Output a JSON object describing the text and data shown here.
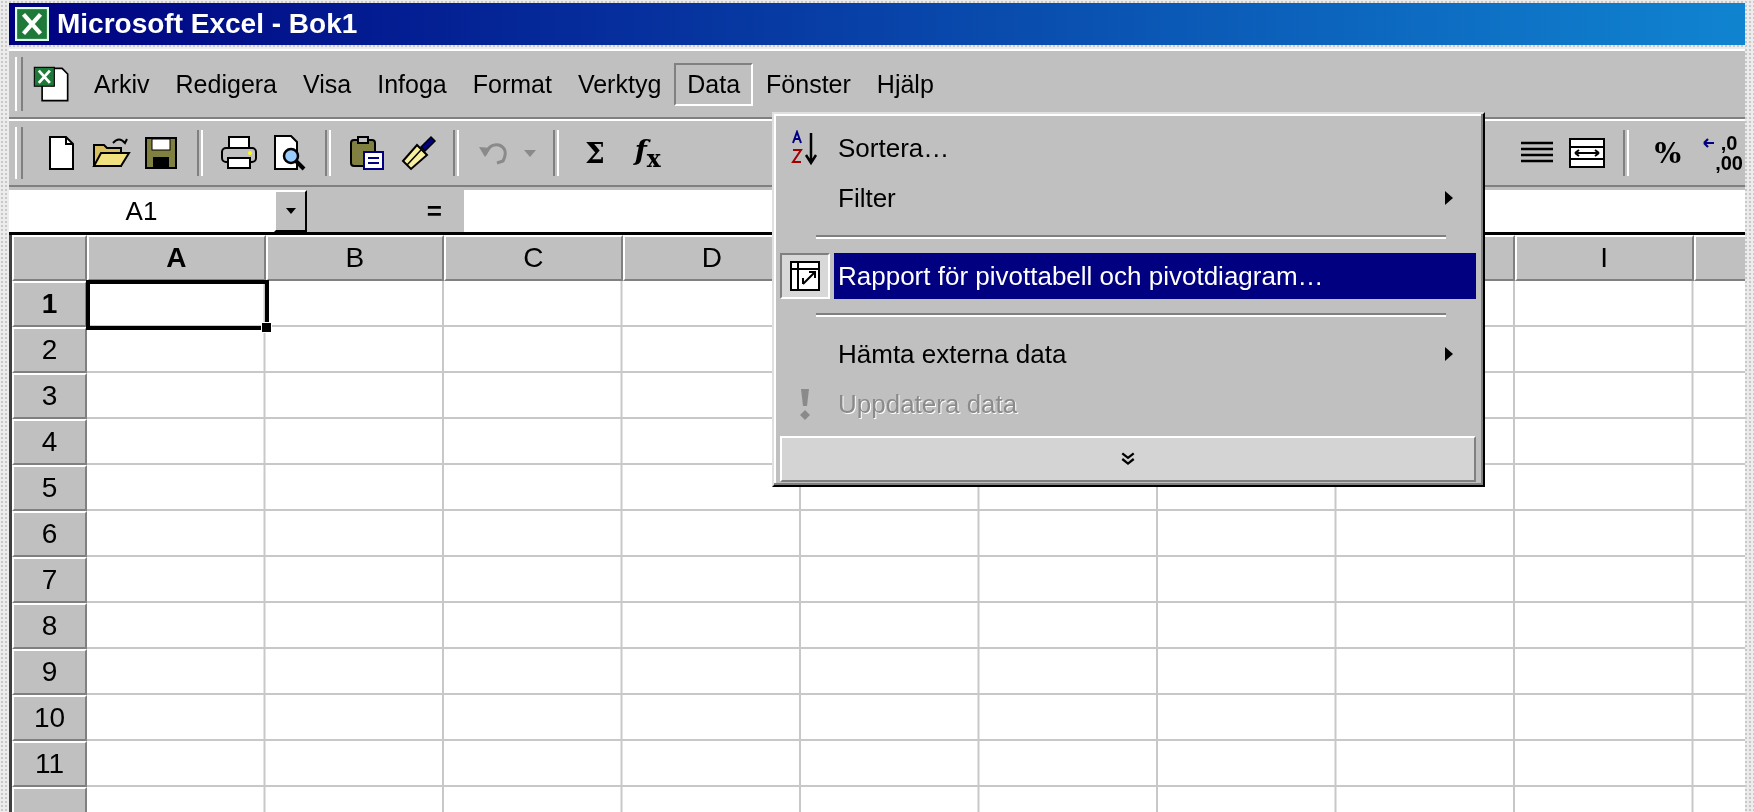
{
  "window": {
    "title": "Microsoft Excel - Bok1"
  },
  "menu_bar": [
    {
      "label": "Arkiv",
      "selected": false
    },
    {
      "label": "Redigera",
      "selected": false
    },
    {
      "label": "Visa",
      "selected": false
    },
    {
      "label": "Infoga",
      "selected": false
    },
    {
      "label": "Format",
      "selected": false
    },
    {
      "label": "Verktyg",
      "selected": false
    },
    {
      "label": "Data",
      "selected": true
    },
    {
      "label": "Fönster",
      "selected": false
    },
    {
      "label": "Hjälp",
      "selected": false
    }
  ],
  "toolbar": {
    "left": [
      {
        "kind": "new"
      },
      {
        "kind": "open"
      },
      {
        "kind": "save"
      },
      {
        "kind": "separator"
      },
      {
        "kind": "print"
      },
      {
        "kind": "preview"
      },
      {
        "kind": "separator"
      },
      {
        "kind": "paste"
      },
      {
        "kind": "brush"
      },
      {
        "kind": "separator"
      },
      {
        "kind": "undo",
        "disabled": true
      },
      {
        "kind": "separator"
      },
      {
        "kind": "glyph",
        "text": "Σ"
      },
      {
        "kind": "glyph",
        "text": "*f*$_{x}$"
      }
    ],
    "right": [
      {
        "kind": "justify"
      },
      {
        "kind": "merge"
      },
      {
        "kind": "separator"
      },
      {
        "kind": "glyph",
        "text": "%"
      },
      {
        "kind": "decimal",
        "lines": [
          ",0",
          ",00"
        ]
      }
    ]
  },
  "formula_bar": {
    "name_box": "A1",
    "equals": "="
  },
  "sheet": {
    "columns": [
      {
        "label": "A",
        "selected": true
      },
      {
        "label": "B",
        "selected": false
      },
      {
        "label": "C",
        "selected": false
      },
      {
        "label": "D",
        "selected": false
      },
      {
        "label": "I",
        "selected": false
      }
    ],
    "rows": [
      {
        "label": "1",
        "selected": true
      },
      {
        "label": "2",
        "selected": false
      },
      {
        "label": "3",
        "selected": false
      },
      {
        "label": "4",
        "selected": false
      },
      {
        "label": "5",
        "selected": false
      },
      {
        "label": "6",
        "selected": false
      },
      {
        "label": "7",
        "selected": false
      },
      {
        "label": "8",
        "selected": false
      },
      {
        "label": "9",
        "selected": false
      },
      {
        "label": "10",
        "selected": false
      },
      {
        "label": "11",
        "selected": false
      }
    ]
  },
  "data_menu": [
    {
      "kind": "sort",
      "label": "Sortera…",
      "selected": false,
      "disabled": false,
      "submenu": false
    },
    {
      "kind": "plain",
      "label": "Filter",
      "selected": false,
      "disabled": false,
      "submenu": true
    },
    {
      "kind": "separator"
    },
    {
      "kind": "pivot",
      "label": "Rapport för pivottabell och pivotdiagram…",
      "selected": true,
      "disabled": false,
      "submenu": false
    },
    {
      "kind": "separator"
    },
    {
      "kind": "plain",
      "label": "Hämta externa data",
      "selected": false,
      "disabled": false,
      "submenu": true
    },
    {
      "kind": "refresh",
      "label": "Uppdatera data",
      "selected": false,
      "disabled": true,
      "submenu": false
    },
    {
      "kind": "expand"
    }
  ]
}
